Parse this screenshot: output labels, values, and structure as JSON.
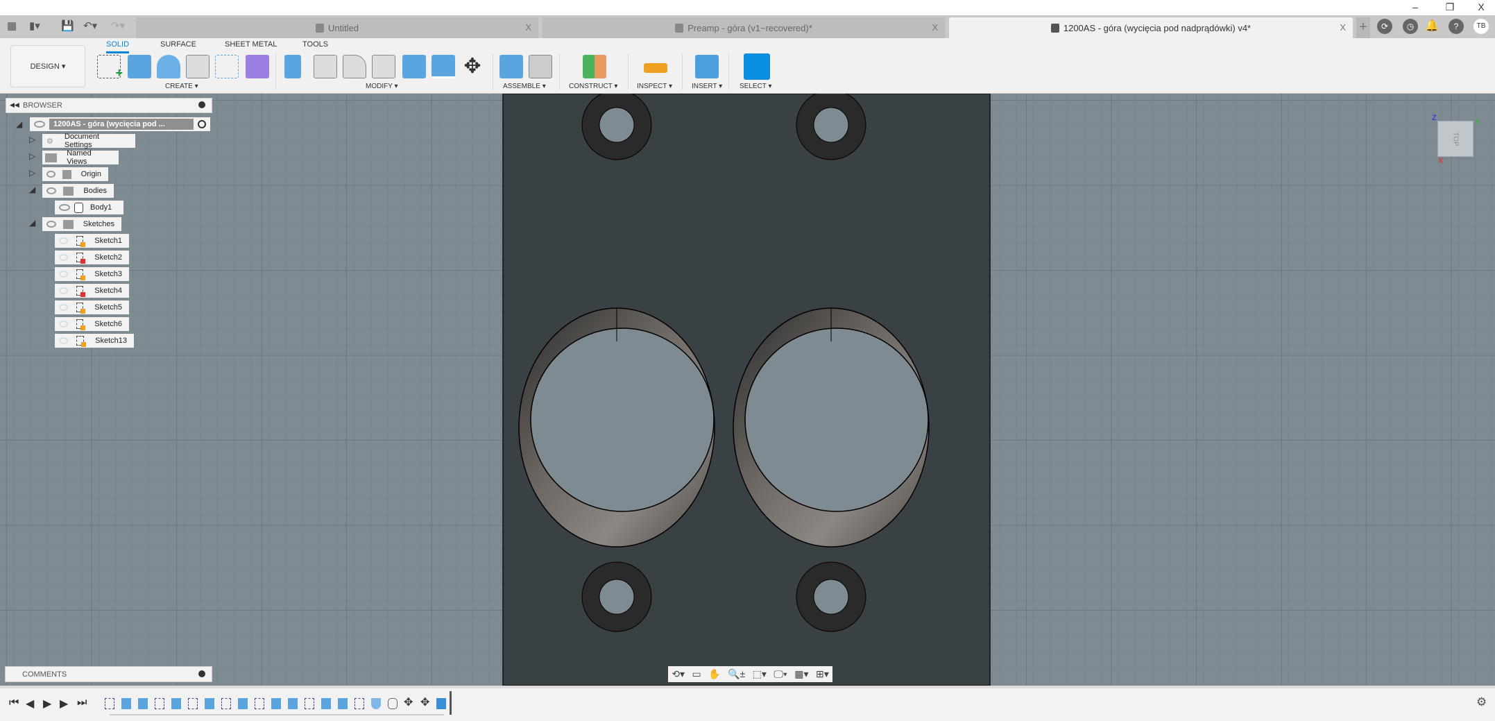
{
  "window": {
    "minimize": "–",
    "restore": "❐",
    "close": "X"
  },
  "tabs": [
    {
      "label": "Untitled",
      "close": "X",
      "active": false
    },
    {
      "label": "Preamp - góra (v1~recovered)*",
      "close": "X",
      "active": false
    },
    {
      "label": "1200AS - góra (wycięcia pod nadprądówki) v4*",
      "close": "X",
      "active": true
    }
  ],
  "tabbar": {
    "new_tab": "+",
    "user_initials": "TB"
  },
  "toolbar": {
    "workspace": "DESIGN ▾",
    "tabs": [
      "SOLID",
      "SURFACE",
      "SHEET METAL",
      "TOOLS"
    ],
    "groups": [
      "CREATE ▾",
      "MODIFY ▾",
      "ASSEMBLE ▾",
      "CONSTRUCT ▾",
      "INSPECT ▾",
      "INSERT ▾",
      "SELECT ▾"
    ]
  },
  "browser": {
    "title": "BROWSER",
    "root": "1200AS - góra (wycięcia pod ...",
    "items": [
      {
        "label": "Document Settings"
      },
      {
        "label": "Named Views"
      },
      {
        "label": "Origin"
      },
      {
        "label": "Bodies"
      },
      {
        "label": "Body1"
      },
      {
        "label": "Sketches"
      }
    ],
    "sketches": [
      {
        "label": "Sketch1",
        "locked": false
      },
      {
        "label": "Sketch2",
        "locked": true
      },
      {
        "label": "Sketch3",
        "locked": false
      },
      {
        "label": "Sketch4",
        "locked": true
      },
      {
        "label": "Sketch5",
        "locked": false
      },
      {
        "label": "Sketch6",
        "locked": false
      },
      {
        "label": "Sketch13",
        "locked": false
      }
    ]
  },
  "comments": {
    "title": "COMMENTS"
  },
  "viewcube": {
    "face": "TOP",
    "axes": {
      "z": "Z",
      "y": "Y",
      "x": "X"
    }
  },
  "colors": {
    "accent": "#0a84d6",
    "viewport": "#7f8b92",
    "body": "#3a4145"
  }
}
